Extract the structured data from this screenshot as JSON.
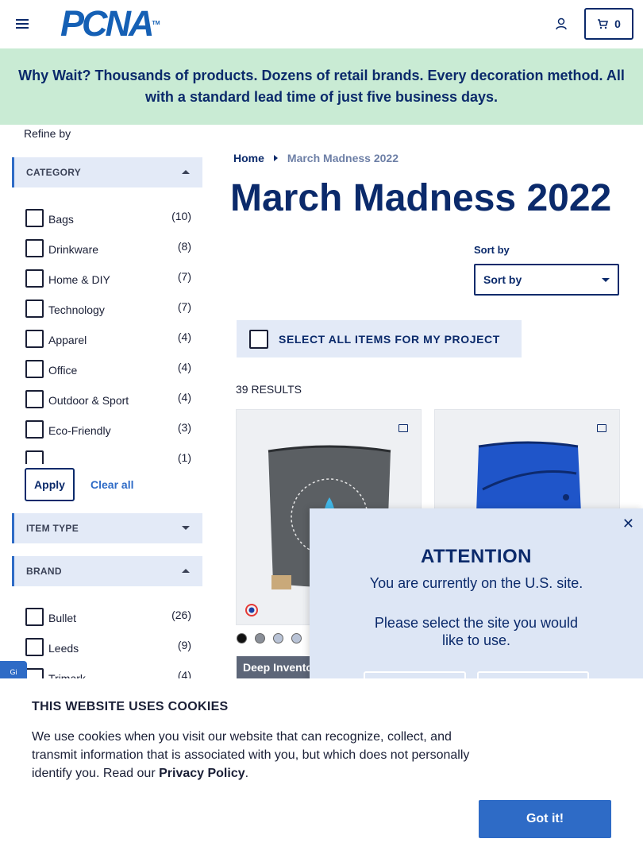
{
  "header": {
    "logo": "PCNA",
    "logo_tm": "TM",
    "cart_count": "0"
  },
  "banner": {
    "text": "Why Wait? Thousands of products. Dozens of retail brands. Every decoration method. All with a standard lead time of just five business days."
  },
  "sidebar": {
    "refine_label": "Refine by",
    "category": {
      "title": "CATEGORY",
      "items": [
        {
          "label": "Bags",
          "count": "(10)"
        },
        {
          "label": "Drinkware",
          "count": "(8)"
        },
        {
          "label": "Home & DIY",
          "count": "(7)"
        },
        {
          "label": "Technology",
          "count": "(7)"
        },
        {
          "label": "Apparel",
          "count": "(4)"
        },
        {
          "label": "Office",
          "count": "(4)"
        },
        {
          "label": "Outdoor & Sport",
          "count": "(4)"
        },
        {
          "label": "Eco-Friendly",
          "count": "(3)"
        },
        {
          "label": "",
          "count": "(1)"
        }
      ]
    },
    "apply_label": "Apply",
    "clear_label": "Clear all",
    "item_type": {
      "title": "ITEM TYPE"
    },
    "brand": {
      "title": "BRAND",
      "items": [
        {
          "label": "Bullet",
          "count": "(26)"
        },
        {
          "label": "Leeds",
          "count": "(9)"
        },
        {
          "label": "Trimark",
          "count": "(4)"
        }
      ]
    },
    "gift_tab": "Gi"
  },
  "main": {
    "breadcrumb": {
      "home": "Home",
      "current": "March Madness 2022"
    },
    "title": "March Madness 2022",
    "sort": {
      "label": "Sort by",
      "value": "Sort by"
    },
    "select_all": "SELECT ALL ITEMS FOR MY PROJECT",
    "results": "39 RESULTS",
    "product1": {
      "badge": "Deep Inventory",
      "swatch_colors": [
        "#111111",
        "#8a8f98",
        "#b9c3d6",
        "#b9c3d6"
      ]
    },
    "product2": {}
  },
  "modal": {
    "title": "ATTENTION",
    "line1": "You are currently on the U.S. site.",
    "line2": "Please select the site you would like to use."
  },
  "cookie": {
    "title": "THIS WEBSITE USES COOKIES",
    "text": "We use cookies when you visit our website that can recognize, collect, and transmit information that is associated with you, but which does not personally identify you. Read our ",
    "link": "Privacy Policy",
    "end": ".",
    "button": "Got it!"
  },
  "colors": {
    "navy": "#0b2a6b",
    "brand_blue": "#1560b5",
    "accent_blue": "#2e6bc6",
    "banner_green": "#c9ebd4",
    "facet_bg": "#e3eaf7",
    "modal_bg": "#dde6f5"
  }
}
